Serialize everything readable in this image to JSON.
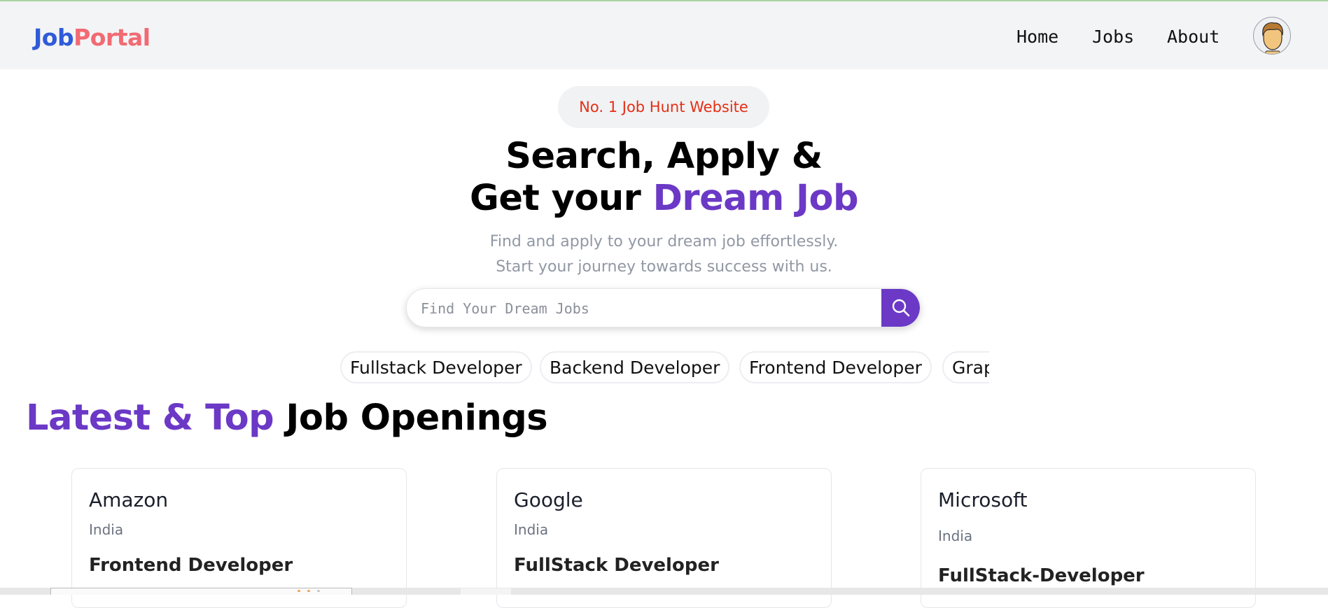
{
  "logo": {
    "part1": "Job",
    "part2": "Portal"
  },
  "nav": {
    "home": "Home",
    "jobs": "Jobs",
    "about": "About"
  },
  "hero": {
    "badge": "No. 1 Job Hunt Website",
    "title_line1": "Search, Apply &",
    "title_line2_prefix": "Get your ",
    "title_line2_highlight": "Dream Job",
    "subtitle_line1": "Find and apply to your dream job effortlessly.",
    "subtitle_line2": "Start your journey towards success with us."
  },
  "search": {
    "placeholder": "Find Your Dream Jobs",
    "value": ""
  },
  "categories": [
    "Fullstack Developer",
    "Backend Developer",
    "Frontend Developer",
    "GraphQL Developer"
  ],
  "section": {
    "title_highlight": "Latest & Top",
    "title_rest": " Job Openings"
  },
  "jobs": [
    {
      "company": "Amazon",
      "location": "India",
      "role": "Frontend Developer"
    },
    {
      "company": "Google",
      "location": "India",
      "role": "FullStack Developer"
    },
    {
      "company": "Microsoft",
      "location": "India",
      "role": "FullStack-Developer"
    }
  ],
  "colors": {
    "accent": "#6b39c6",
    "logo_blue": "#2f5bd8",
    "logo_pink": "#f26a72",
    "badge_text": "#e42f14"
  },
  "icons": {
    "search": "search-icon",
    "avatar": "user-avatar-icon"
  }
}
